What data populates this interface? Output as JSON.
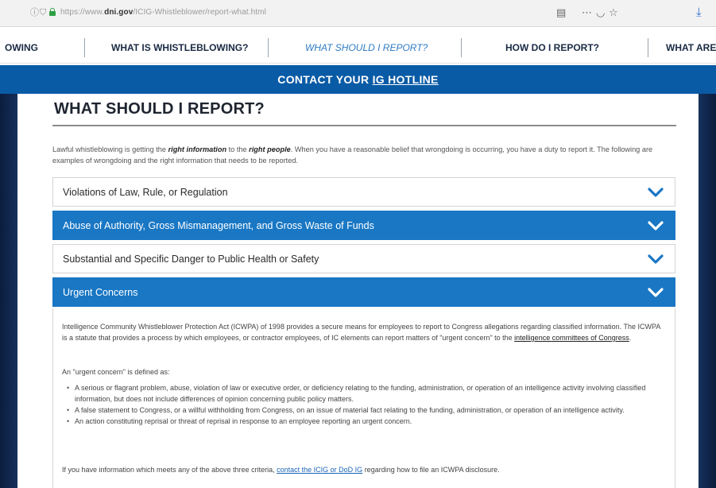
{
  "browser": {
    "url_prefix": "https://www.",
    "url_host": "dni.gov",
    "url_path": "/ICIG-Whistleblower/report-what.html",
    "icons": [
      "info-icon",
      "shield-icon",
      "lock-icon",
      "reader-view-icon",
      "more-icon",
      "pocket-icon",
      "bookmark-star-icon",
      "download-icon"
    ]
  },
  "nav": {
    "items": [
      {
        "label": "OWING",
        "active": false
      },
      {
        "label": "WHAT IS WHISTLEBLOWING?",
        "active": false
      },
      {
        "label": "WHAT SHOULD I REPORT?",
        "active": true
      },
      {
        "label": "HOW DO I REPORT?",
        "active": false
      },
      {
        "label": "WHAT ARE",
        "active": false
      }
    ]
  },
  "hotline": {
    "prefix": "CONTACT YOUR ",
    "link": "IG HOTLINE"
  },
  "page": {
    "title": "WHAT SHOULD I REPORT?",
    "intro_1": "Lawful whistleblowing is getting the ",
    "intro_bold_1": "right information",
    "intro_2": " to the ",
    "intro_bold_2": "right people",
    "intro_3": ". When you have a reasonable belief that wrongdoing is occurring, you have a duty to report it. The following are examples of wrongdoing and the right information that needs to be reported."
  },
  "accordion": [
    {
      "label": "Violations of Law, Rule, or Regulation",
      "open": false
    },
    {
      "label": "Abuse of Authority, Gross Mismanagement, and Gross Waste of Funds",
      "open": true
    },
    {
      "label": "Substantial and Specific Danger to Public Health or Safety",
      "open": false
    },
    {
      "label": "Urgent Concerns",
      "open": true
    }
  ],
  "urgent": {
    "para_1": "Intelligence Community Whistleblower Protection Act (ICWPA) of 1998 provides a secure means for employees to report to Congress allegations regarding classified information. The ICWPA is a statute that provides a process by which employees, or contractor employees, of IC elements can report matters of \"urgent concern\" to the ",
    "para_1_link": "intelligence committees of Congress",
    "para_1_end": ".",
    "defined": "An \"urgent concern\" is defined as:",
    "bullets": [
      "A serious or flagrant problem, abuse, violation of law or executive order, or deficiency relating to the funding, administration, or operation of an intelligence activity involving classified information, but does not include differences of opinion concerning public policy matters.",
      "A false statement to Congress, or a willful withholding from Congress, on an issue of material fact relating to the funding, administration, or operation of an intelligence activity.",
      "An action constituting reprisal or threat of reprisal in response to an employee reporting an urgent concern."
    ],
    "footer_1": "If you have information which meets any of the above three criteria, ",
    "footer_link": "contact the ICIG or DoD IG",
    "footer_2": " regarding how to file an ICWPA disclosure."
  }
}
